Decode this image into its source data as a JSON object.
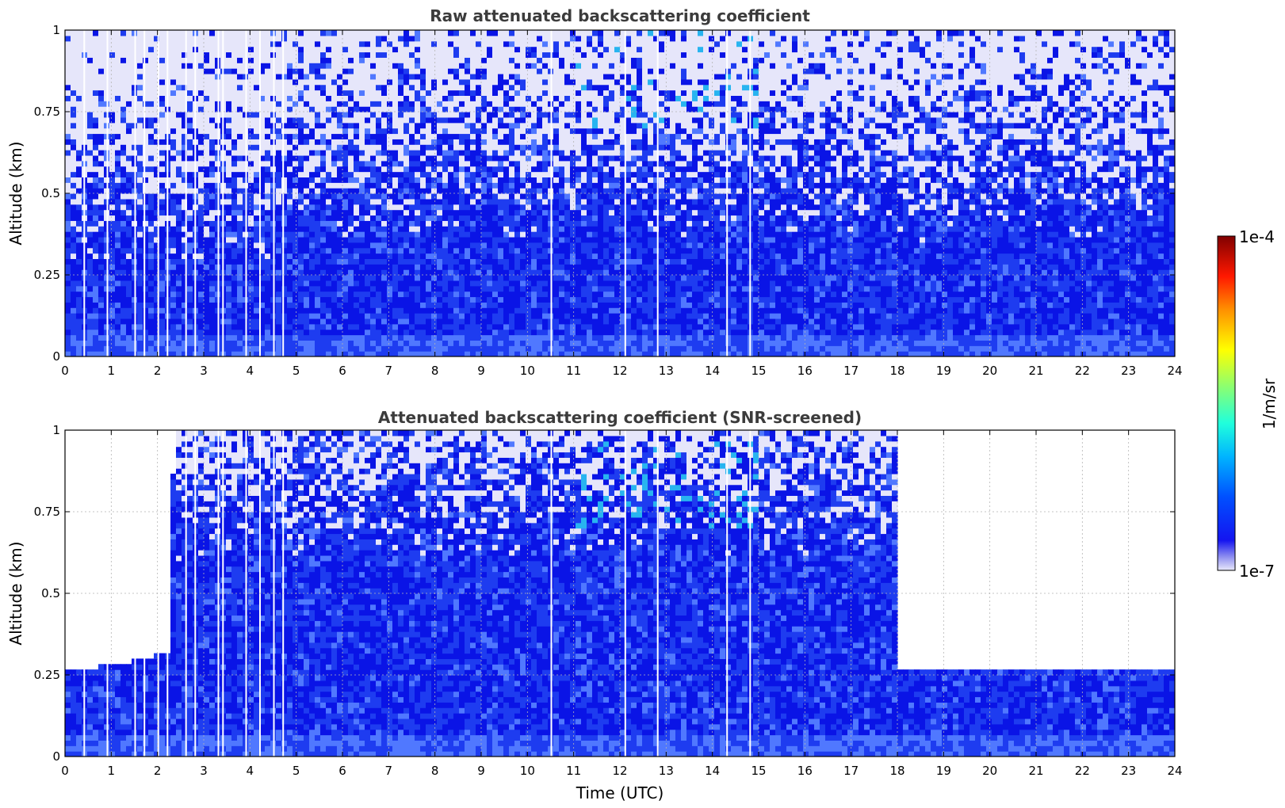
{
  "colors": {
    "background": "#ffffff",
    "title_text": "#3c3c3c",
    "deep_blue": "#0a14e6",
    "mid_blue": "#1e3cf0",
    "light_blue": "#5078ff",
    "cyan": "#28b4f0",
    "pale_lavender": "#e6e6fa",
    "grid": "#b4b4b4"
  },
  "chart_data": [
    {
      "type": "heatmap",
      "title": "Raw attenuated backscattering coefficient",
      "xlabel": "",
      "ylabel": "Altitude (km)",
      "xlim": [
        0,
        24
      ],
      "ylim": [
        0,
        1
      ],
      "x_ticks": [
        "0",
        "1",
        "2",
        "3",
        "4",
        "5",
        "6",
        "7",
        "8",
        "9",
        "10",
        "11",
        "12",
        "13",
        "14",
        "15",
        "16",
        "17",
        "18",
        "19",
        "20",
        "21",
        "22",
        "23",
        "24"
      ],
      "y_ticks": [
        "0",
        "0.25",
        "0.5",
        "0.75",
        "1"
      ],
      "grid": true,
      "profile_sketch": {
        "altitudes": [
          0.0,
          0.05,
          0.15,
          0.25,
          0.35,
          0.45,
          0.55,
          0.65,
          0.75,
          0.85,
          0.95
        ],
        "times": [
          0,
          2,
          4,
          6,
          8,
          10,
          12,
          14,
          16,
          18,
          20,
          22,
          24
        ],
        "log10_backscatter_approx": [
          [
            -5.9,
            -6.0,
            -6.2,
            -6.4,
            -6.6,
            -6.7,
            -6.8,
            -6.9,
            -7.0,
            -7.0,
            -7.0
          ],
          [
            -5.9,
            -6.0,
            -6.2,
            -6.4,
            -6.6,
            -6.7,
            -6.8,
            -6.9,
            -7.0,
            -7.0,
            -7.0
          ],
          [
            -5.9,
            -6.0,
            -6.1,
            -6.3,
            -6.5,
            -6.6,
            -6.7,
            -6.8,
            -6.9,
            -7.0,
            -7.0
          ],
          [
            -5.9,
            -6.0,
            -6.1,
            -6.2,
            -6.3,
            -6.4,
            -6.5,
            -6.6,
            -6.7,
            -6.8,
            -6.8
          ],
          [
            -5.9,
            -6.0,
            -6.1,
            -6.2,
            -6.3,
            -6.4,
            -6.5,
            -6.6,
            -6.7,
            -6.8,
            -6.8
          ],
          [
            -5.9,
            -6.0,
            -6.1,
            -6.2,
            -6.3,
            -6.4,
            -6.5,
            -6.6,
            -6.7,
            -6.7,
            -6.7
          ],
          [
            -5.9,
            -6.0,
            -6.1,
            -6.3,
            -6.5,
            -6.6,
            -6.6,
            -6.5,
            -6.4,
            -6.3,
            -6.3
          ],
          [
            -5.9,
            -6.0,
            -6.1,
            -6.3,
            -6.5,
            -6.6,
            -6.7,
            -6.7,
            -6.6,
            -6.6,
            -6.6
          ],
          [
            -5.9,
            -6.0,
            -6.1,
            -6.3,
            -6.4,
            -6.5,
            -6.6,
            -6.6,
            -6.6,
            -6.6,
            -6.6
          ],
          [
            -5.9,
            -6.0,
            -6.1,
            -6.3,
            -6.5,
            -6.6,
            -6.7,
            -6.7,
            -6.7,
            -6.7,
            -6.7
          ],
          [
            -5.9,
            -6.0,
            -6.1,
            -6.3,
            -6.5,
            -6.6,
            -6.7,
            -6.7,
            -6.7,
            -6.6,
            -6.6
          ],
          [
            -5.9,
            -6.0,
            -6.1,
            -6.3,
            -6.5,
            -6.6,
            -6.7,
            -6.7,
            -6.7,
            -6.6,
            -6.6
          ],
          [
            -5.9,
            -6.0,
            -6.1,
            -6.3,
            -6.5,
            -6.6,
            -6.7,
            -6.7,
            -6.7,
            -6.6,
            -6.6
          ]
        ]
      }
    },
    {
      "type": "heatmap",
      "title": "Attenuated backscattering coefficient (SNR-screened)",
      "xlabel": "Time (UTC)",
      "ylabel": "Altitude (km)",
      "xlim": [
        0,
        24
      ],
      "ylim": [
        0,
        1
      ],
      "x_ticks": [
        "0",
        "1",
        "2",
        "3",
        "4",
        "5",
        "6",
        "7",
        "8",
        "9",
        "10",
        "11",
        "12",
        "13",
        "14",
        "15",
        "16",
        "17",
        "18",
        "19",
        "20",
        "21",
        "22",
        "23",
        "24"
      ],
      "y_ticks": [
        "0",
        "0.25",
        "0.5",
        "0.75",
        "1"
      ],
      "grid": true,
      "valid_data_top_km": {
        "times": [
          0,
          1,
          2,
          2.3,
          2.35,
          18.0,
          18.05,
          24
        ],
        "top_km": [
          0.26,
          0.28,
          0.31,
          0.32,
          1.0,
          1.0,
          0.26,
          0.26
        ]
      }
    }
  ],
  "colorbar": {
    "label": "1/m/sr",
    "max_label": "1e-4",
    "min_label": "1e-7",
    "range": [
      1e-07,
      0.0001
    ],
    "scale": "log",
    "colormap": "jet"
  }
}
